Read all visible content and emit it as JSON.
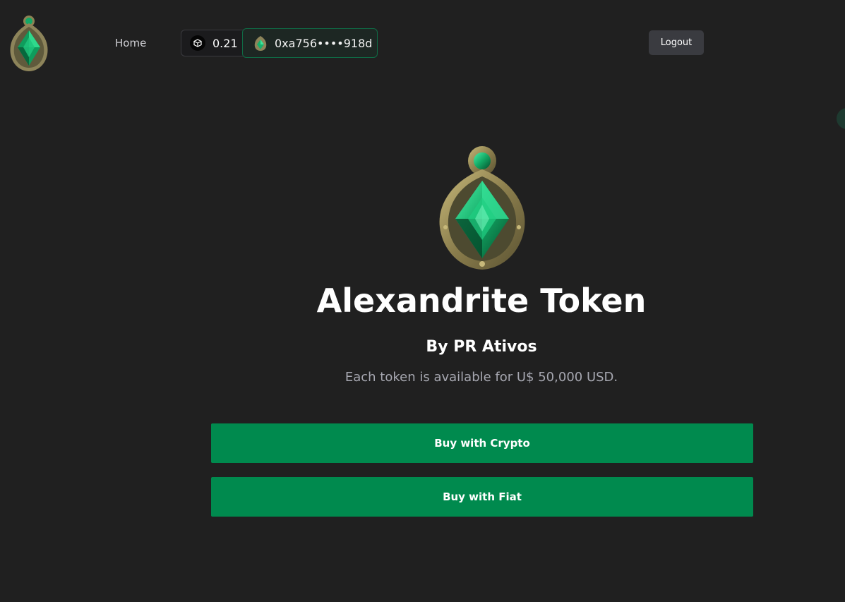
{
  "header": {
    "logo_icon": "alexandrite-gem-logo",
    "nav": {
      "home_label": "Home"
    },
    "balance": {
      "icon": "cube-icon",
      "value": "0.21"
    },
    "wallet": {
      "icon": "gem-avatar-icon",
      "address": "0xa756••••918d"
    },
    "logout_label": "Logout"
  },
  "token": {
    "image_icon": "alexandrite-gem-pendant",
    "title": "Alexandrite Token",
    "issuer": "By PR Ativos",
    "price_text": "Each token is available for U$ 50,000 USD."
  },
  "actions": {
    "buy_crypto_label": "Buy with Crypto",
    "buy_fiat_label": "Buy with Fiat"
  },
  "colors": {
    "background": "#202020",
    "accent_green": "#008a4e",
    "wallet_border": "#0f6b45",
    "muted_text": "#a6a7b0",
    "emerald": "#11b46e",
    "gold_frame": "#a89a5c"
  }
}
